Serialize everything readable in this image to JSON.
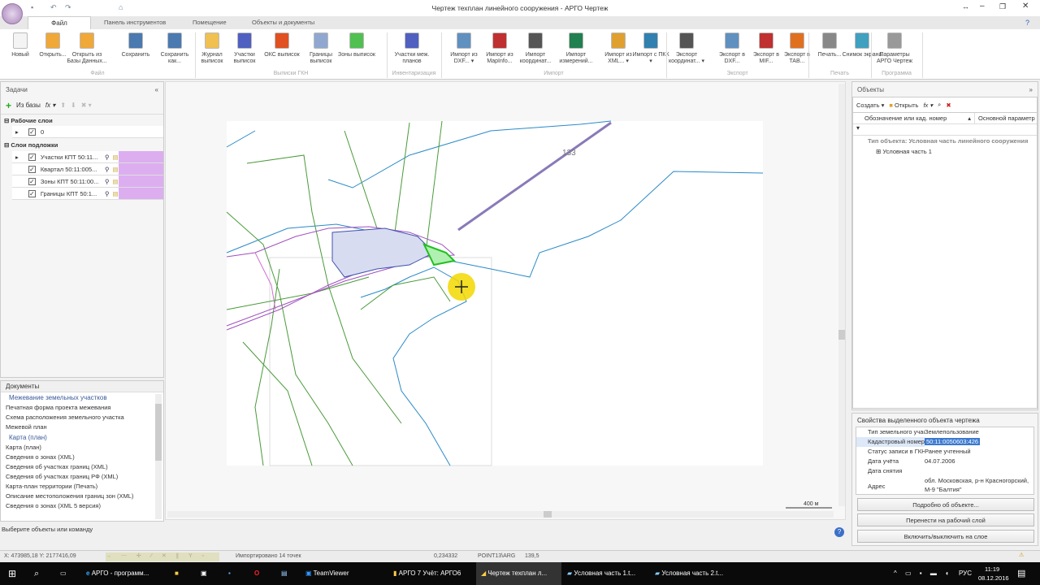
{
  "window": {
    "title": "Чертеж техплан линейного сооружения - АРГО Чертеж"
  },
  "tabs": [
    "Файл",
    "Панель инструментов",
    "Помещение",
    "Объекты и документы"
  ],
  "ribbon": {
    "buttons": [
      {
        "label": "Новый",
        "color": "#f4f4f4"
      },
      {
        "label": "Открыть...",
        "color": "#f0a838"
      },
      {
        "label": "Открыть из Базы Данных...",
        "color": "#f0a838"
      },
      {
        "label": "Сохранить",
        "color": "#4a7ab0"
      },
      {
        "label": "Сохранить как...",
        "color": "#4a7ab0"
      },
      {
        "label": "Журнал выписок",
        "color": "#f0c050"
      },
      {
        "label": "Участки выписок",
        "color": "#5060c0"
      },
      {
        "label": "ОКС выписок",
        "color": "#e05020"
      },
      {
        "label": "Границы выписок",
        "color": "#90a8d0"
      },
      {
        "label": "Зоны выписок",
        "color": "#50c050"
      },
      {
        "label": "Участки меж. планов",
        "color": "#5060c0"
      },
      {
        "label": "Импорт из DXF... ▾",
        "color": "#6090c0"
      },
      {
        "label": "Импорт из MapInfo...",
        "color": "#c03030"
      },
      {
        "label": "Импорт координат...",
        "color": "#555"
      },
      {
        "label": "Импорт измерений...",
        "color": "#208050"
      },
      {
        "label": "Импорт из XML... ▾",
        "color": "#e0a030"
      },
      {
        "label": "Импорт с ПКК ▾",
        "color": "#3080b0"
      },
      {
        "label": "Экспорт координат... ▾",
        "color": "#555"
      },
      {
        "label": "Экспорт в DXF...",
        "color": "#6090c0"
      },
      {
        "label": "Экспорт в MIF...",
        "color": "#c03030"
      },
      {
        "label": "Экспорт в TAB...",
        "color": "#e07020"
      },
      {
        "label": "Печать...",
        "color": "#888"
      },
      {
        "label": "Снимок экрана",
        "color": "#40a0c0"
      },
      {
        "label": "Параметры АРГО Чертеж",
        "color": "#999"
      }
    ],
    "groups": [
      "Файл",
      "Выписки ГКН",
      "Инвентаризация",
      "Импорт",
      "Экспорт",
      "Печать",
      "Программа"
    ]
  },
  "tasks": {
    "title": "Задачи",
    "from_db": "Из базы",
    "working_layers": {
      "title": "Рабочие слои",
      "items": [
        "0"
      ]
    },
    "base_layers": {
      "title": "Слои подложки",
      "items": [
        "Участки КПТ 50:11...",
        "Квартал 50:11:005...",
        "Зоны КПТ 50:11:00...",
        "Границы КПТ 50:1..."
      ]
    }
  },
  "documents": {
    "title": "Документы",
    "groups": [
      {
        "name": "Межевание земельных участков",
        "items": [
          "Печатная форма проекта межевания",
          "Схема расположения земельного участка",
          "Межевой план"
        ]
      },
      {
        "name": "Карта (план)",
        "items": [
          "Карта (план)",
          "Сведения о зонах (XML)",
          "Сведения об участках границ (XML)",
          "Сведения об участках границ РФ (XML)",
          "Карта-план территории (Печать)",
          "Описание местоположения границ зон (XML)",
          "Сведения о зонах (XML 5 версия)"
        ]
      }
    ]
  },
  "canvas": {
    "label": "133",
    "scale": "400 м"
  },
  "objects": {
    "title": "Объекты",
    "create": "Создать",
    "open": "Открыть",
    "columns": [
      "Обозначение или кад. номер",
      "Основной параметр"
    ],
    "group": "Тип объекта: Условная часть линейного сооружения",
    "items": [
      "Условная часть 1"
    ]
  },
  "properties": {
    "title": "Свойства выделенного объекта чертежа",
    "rows": [
      {
        "k": "Тип земельного участка",
        "v": "Землепользование"
      },
      {
        "k": "Кадастровый номер",
        "v": "50:11:0050603:426"
      },
      {
        "k": "Статус записи в ГКН",
        "v": "Ранее учтенный"
      },
      {
        "k": "Дата учёта",
        "v": "04.07.2006"
      },
      {
        "k": "Дата снятия",
        "v": ""
      },
      {
        "k": "Адрес",
        "v": "обл. Московская, р-н Красногорский, М-9 \"Балтия\""
      }
    ],
    "buttons": [
      "Подробно об объекте...",
      "Перенести на рабочий слой",
      "Включить/выключить на слое"
    ]
  },
  "status": {
    "hint": "Выберите объекты или команду",
    "coords": "X: 473985,18 Y: 2177416,09",
    "message": "Импортировано 14 точек",
    "value": "0,234332",
    "point": "POINT13\\ARG",
    "num": "139,5"
  },
  "taskbar": {
    "items": [
      "АРГО - программ...",
      "TeamViewer",
      "АРГО 7 Учёт: АРГО6",
      "Чертеж техплан л...",
      "Условная часть 1.t...",
      "Условная часть 2.t..."
    ],
    "lang": "РУС",
    "time": "11:19",
    "date": "08.12.2016"
  }
}
